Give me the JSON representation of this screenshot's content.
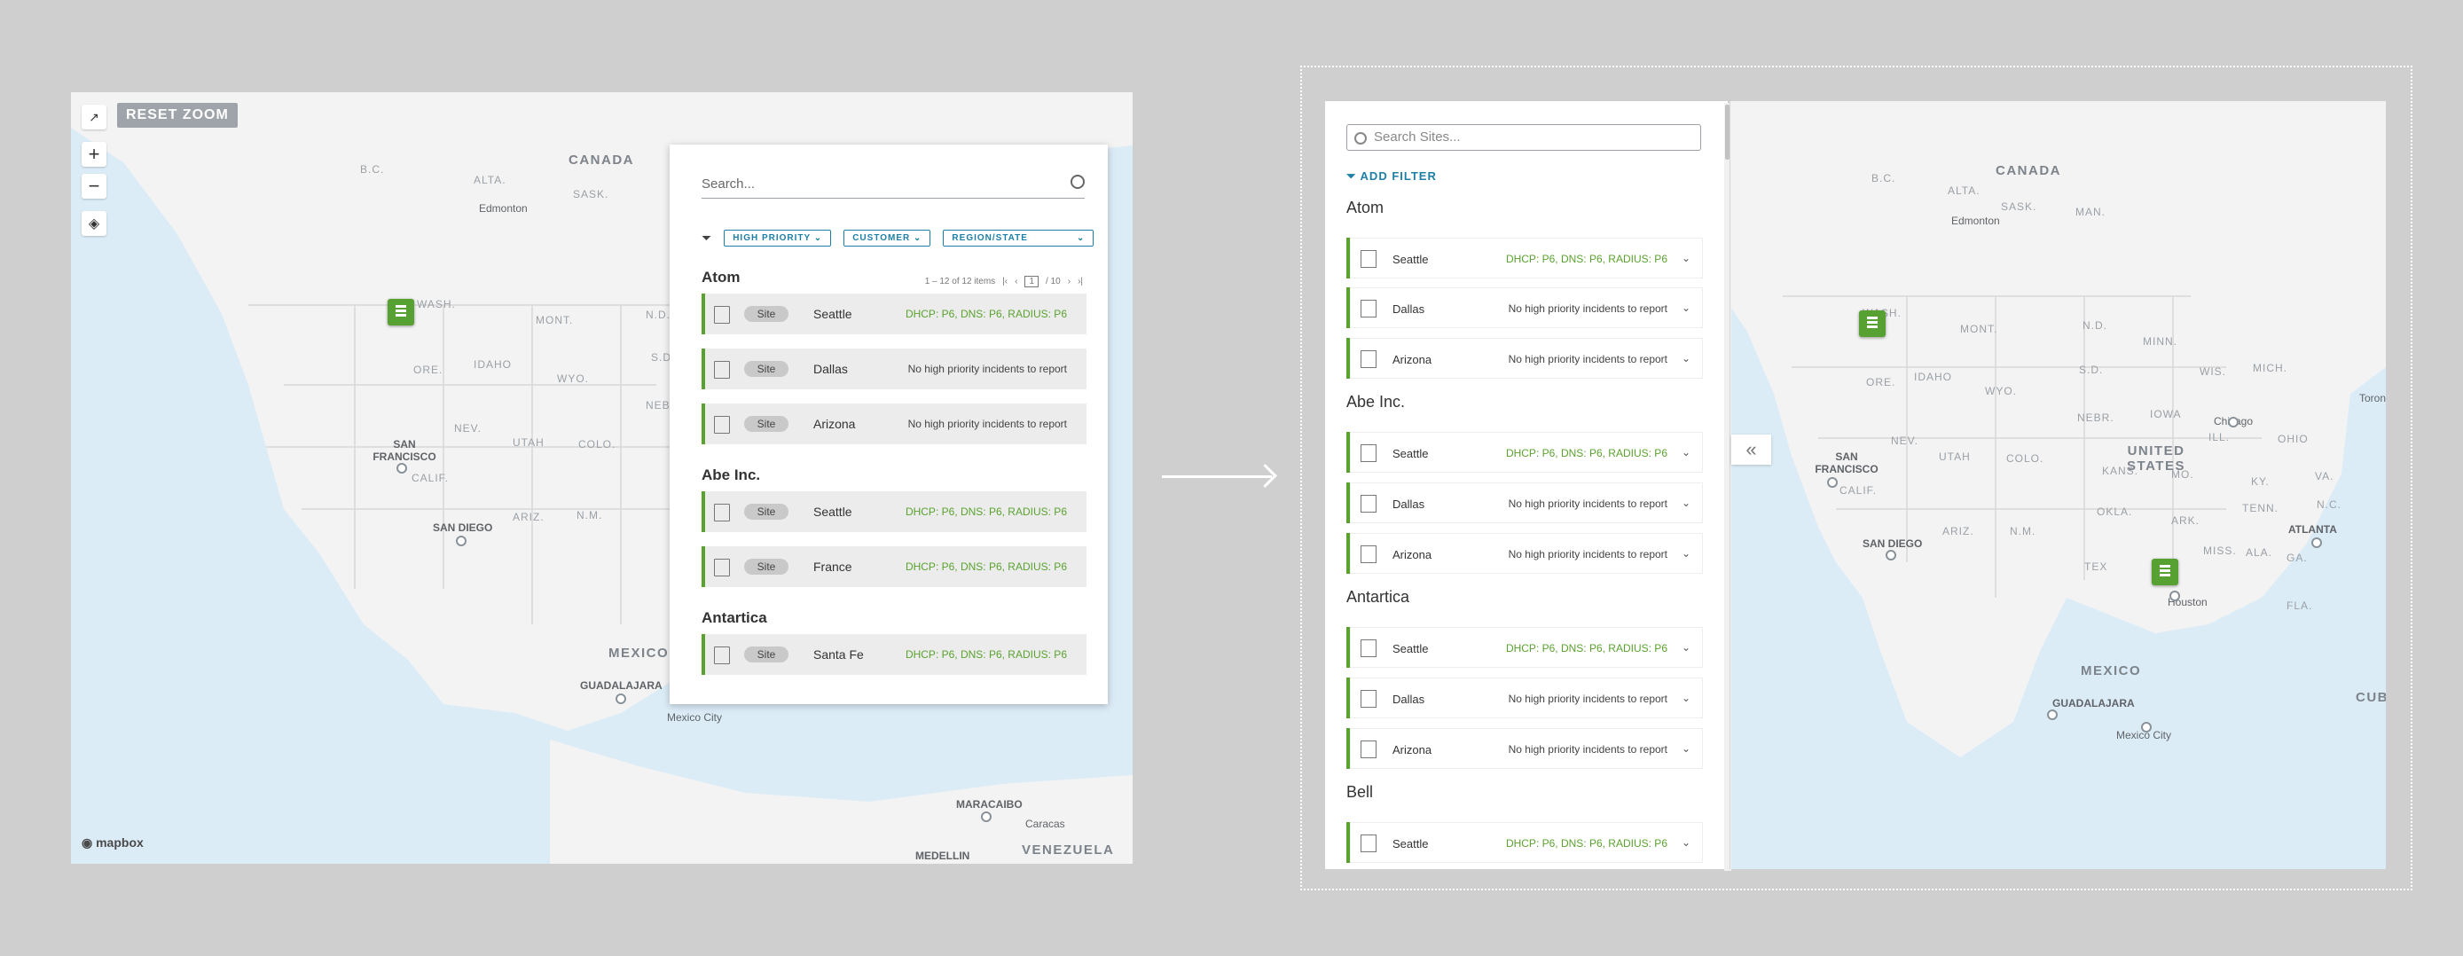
{
  "left_map": {
    "reset_zoom": "RESET ZOOM",
    "zoom_in": "+",
    "zoom_out": "−",
    "attribution": "mapbox",
    "labels": {
      "canada": "CANADA",
      "bc": "B.C.",
      "alta": "ALTA.",
      "sask": "SASK.",
      "wash": "WASH.",
      "mont": "MONT.",
      "nd": "N.D.",
      "ore": "ORE.",
      "idaho": "IDAHO",
      "wyo": "WYO.",
      "sd": "S.D",
      "nebr": "NEB",
      "nev": "NEV.",
      "utah": "UTAH",
      "colo": "COLO.",
      "calif": "CALIF.",
      "ariz": "ARIZ.",
      "nm": "N.M.",
      "mexico": "MEXICO",
      "venezuela": "VENEZUELA"
    },
    "cities": {
      "edmonton": "Edmonton",
      "sf": "SAN FRANCISCO",
      "sandiego": "SAN DIEGO",
      "guadalajara": "GUADALAJARA",
      "mexicocity": "Mexico City",
      "maracaibo": "MARACAIBO",
      "medellin": "MEDELLIN",
      "caracas": "Caracas"
    }
  },
  "panel_a": {
    "search_placeholder": "Search...",
    "filters": [
      "HIGH PRIORITY",
      "CUSTOMER",
      "REGION/STATE"
    ],
    "pager": {
      "range": "1 – 12 of 12 items",
      "page": "1",
      "total": "/ 10"
    },
    "groups": [
      {
        "name": "Atom",
        "rows": [
          {
            "tag": "Site",
            "name": "Seattle",
            "status": "DHCP: P6, DNS: P6, RADIUS: P6",
            "ok": true
          },
          {
            "tag": "Site",
            "name": "Dallas",
            "status": "No high priority incidents to report",
            "ok": false
          },
          {
            "tag": "Site",
            "name": "Arizona",
            "status": "No high priority incidents to report",
            "ok": false
          }
        ]
      },
      {
        "name": "Abe Inc.",
        "rows": [
          {
            "tag": "Site",
            "name": "Seattle",
            "status": "DHCP: P6, DNS: P6, RADIUS: P6",
            "ok": true
          },
          {
            "tag": "Site",
            "name": "France",
            "status": "DHCP: P6, DNS: P6, RADIUS: P6",
            "ok": true
          }
        ]
      },
      {
        "name": "Antartica",
        "rows": [
          {
            "tag": "Site",
            "name": "Santa Fe",
            "status": "DHCP: P6, DNS: P6, RADIUS: P6",
            "ok": true
          }
        ]
      }
    ]
  },
  "right_panel": {
    "search_placeholder": "Search Sites...",
    "add_filter": "ADD FILTER",
    "groups": [
      {
        "name": "Atom",
        "rows": [
          {
            "name": "Seattle",
            "status": "DHCP: P6, DNS: P6, RADIUS: P6",
            "ok": true
          },
          {
            "name": "Dallas",
            "status": "No high priority incidents to report",
            "ok": false
          },
          {
            "name": "Arizona",
            "status": "No high priority incidents to report",
            "ok": false
          }
        ]
      },
      {
        "name": "Abe Inc.",
        "rows": [
          {
            "name": "Seattle",
            "status": "DHCP: P6, DNS: P6, RADIUS: P6",
            "ok": true
          },
          {
            "name": "Dallas",
            "status": "No high priority incidents to report",
            "ok": false
          },
          {
            "name": "Arizona",
            "status": "No high priority incidents to report",
            "ok": false
          }
        ]
      },
      {
        "name": "Antartica",
        "rows": [
          {
            "name": "Seattle",
            "status": "DHCP: P6, DNS: P6, RADIUS: P6",
            "ok": true
          },
          {
            "name": "Dallas",
            "status": "No high priority incidents to report",
            "ok": false
          },
          {
            "name": "Arizona",
            "status": "No high priority incidents to report",
            "ok": false
          }
        ]
      },
      {
        "name": "Bell",
        "rows": [
          {
            "name": "Seattle",
            "status": "DHCP: P6, DNS: P6, RADIUS: P6",
            "ok": true
          }
        ]
      }
    ]
  },
  "right_map": {
    "labels": {
      "canada": "CANADA",
      "bc": "B.C.",
      "alta": "ALTA.",
      "sask": "SASK.",
      "man": "MAN.",
      "wash": "WASH.",
      "mont": "MONT.",
      "nd": "N.D.",
      "minn": "MINN.",
      "ore": "ORE.",
      "idaho": "IDAHO",
      "wyo": "WYO.",
      "sd": "S.D.",
      "wis": "WIS.",
      "mich": "MICH.",
      "nev": "NEV.",
      "utah": "UTAH",
      "colo": "COLO.",
      "nebr": "NEBR.",
      "iowa": "IOWA",
      "ill": "ILL.",
      "ohio": "OHIO",
      "us": "UNITED STATES",
      "calif": "CALIF.",
      "kans": "KANS.",
      "mo": "MO.",
      "ky": "KY.",
      "va": "VA.",
      "ariz": "ARIZ.",
      "nm": "N.M.",
      "okla": "OKLA.",
      "tenn": "TENN.",
      "ark": "ARK.",
      "nc": "N.C.",
      "tex": "TEX",
      "miss": "MISS.",
      "ala": "ALA.",
      "ga": "GA.",
      "fla": "FLA.",
      "mexico": "MEXICO",
      "cuba": "CUBA"
    },
    "cities": {
      "edmonton": "Edmonton",
      "chicago": "Chicago",
      "toronto": "Toronto",
      "sf": "SAN FRANCISCO",
      "sandiego": "SAN DIEGO",
      "atlanta": "ATLANTA",
      "houston": "Houston",
      "guadalajara": "GUADALAJARA",
      "mexicocity": "Mexico City"
    }
  }
}
